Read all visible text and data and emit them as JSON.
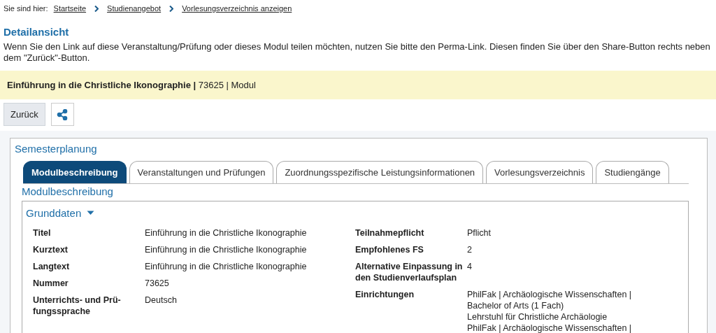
{
  "breadcrumb": {
    "label": "Sie sind hier:",
    "links": [
      "Startseite",
      "Studienangebot",
      "Vorlesungsverzeichnis anzeigen"
    ]
  },
  "heading": "Detailansicht",
  "intro": "Wenn Sie den Link auf diese Veranstaltung/Prüfung oder dieses Modul teilen möchten, nutzen Sie bitte den Perma-Link. Diesen finden Sie über den Share-Button rechts neben dem \"Zurück\"-Button.",
  "title_bar": "**Einführung in die Christliche Ikonographie |** 73625 | Modul",
  "buttons": {
    "back": "Zurück"
  },
  "panel": {
    "title": "Semesterplanung",
    "tabs": [
      {
        "label": "Modulbeschreibung",
        "selected": true
      },
      {
        "label": "Veranstaltungen und Prüfungen",
        "selected": false
      },
      {
        "label": "Zuordnungsspezifische Leistungsinformationen",
        "selected": false
      },
      {
        "label": "Vorlesungsverzeichnis",
        "selected": false
      },
      {
        "label": "Studiengänge",
        "selected": false
      }
    ],
    "section_title": "Modulbeschreibung",
    "group": {
      "title": "Grunddaten",
      "expanded": true,
      "left": [
        {
          "label": "Titel",
          "value": "Einführung in die Christliche Ikonographie"
        },
        {
          "label": "Kurztext",
          "value": "Einführung in die Christliche Ikonographie"
        },
        {
          "label": "Langtext",
          "value": "Einführung in die Christliche Ikonographie"
        },
        {
          "label": "Nummer",
          "value": "73625"
        },
        {
          "label": "Unterrichts- und Prü-fungssprache",
          "value": "Deutsch"
        }
      ],
      "right": [
        {
          "label": "Teilnahmepflicht",
          "value": "Pflicht"
        },
        {
          "label": "Empfohlenes FS",
          "value": "2"
        },
        {
          "label": "Alternative Einpassung in den Studienverlaufsplan",
          "value": "4"
        },
        {
          "label": "Einrichtungen",
          "values": [
            "PhilFak | Archäologische Wissenschaften | Bachelor of Arts (1 Fach)",
            "Lehrstuhl für Christliche Archäologie",
            "PhilFak | Archäologische Wissenschaften |"
          ]
        }
      ]
    }
  }
}
